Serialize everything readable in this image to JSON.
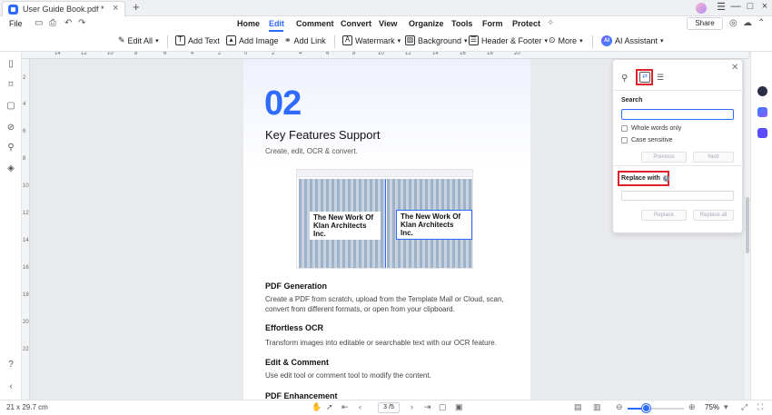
{
  "titlebar": {
    "tab_title": "User Guide Book.pdf *",
    "tab_close": "×",
    "tab_add": "+",
    "win_menu": "☰",
    "win_min": "—",
    "win_max": "□",
    "win_close": "×"
  },
  "menubar": {
    "file": "File",
    "tabs": [
      "Home",
      "Edit",
      "Comment",
      "Convert",
      "View",
      "Organize",
      "Tools",
      "Form",
      "Protect"
    ],
    "active_tab": "Edit",
    "share": "Share",
    "accent": "#2f6bff"
  },
  "toolbar": {
    "edit_all": "Edit All",
    "add_text": "Add Text",
    "add_image": "Add Image",
    "add_link": "Add Link",
    "watermark": "Watermark",
    "background": "Background",
    "header_footer": "Header & Footer",
    "more": "More",
    "ai_assistant": "AI Assistant",
    "ai_badge": "AI"
  },
  "ruler": {
    "h_marks": [
      "14",
      "12",
      "10",
      "8",
      "6",
      "4",
      "2",
      "0",
      "2",
      "4",
      "6",
      "8",
      "10",
      "12",
      "14",
      "16",
      "18",
      "20"
    ],
    "v_marks": [
      "2",
      "4",
      "6",
      "8",
      "10",
      "12",
      "14",
      "16",
      "18",
      "20",
      "22"
    ]
  },
  "document": {
    "chapter_number": "02",
    "chapter_title": "Key Features Support",
    "chapter_subtitle": "Create, edit, OCR & convert.",
    "preview_text_left": "The New Work Of Klan Architects Inc.",
    "preview_text_right": "The New Work Of Klan Architects Inc.",
    "sections": [
      {
        "heading": "PDF Generation",
        "body": "Create a PDF from scratch, upload from the Template Mall or Cloud, scan, convert from different formats, or open from your clipboard."
      },
      {
        "heading": "Effortless OCR",
        "body": "Transform images into editable or searchable text with our OCR feature."
      },
      {
        "heading": "Edit & Comment",
        "body": "Use edit tool or comment tool to modify the content."
      },
      {
        "heading": "PDF Enhancement",
        "body": ""
      }
    ]
  },
  "search_panel": {
    "search_label": "Search",
    "search_value": "",
    "whole_words": "Whole words only",
    "case_sensitive": "Case sensitive",
    "previous": "Previous",
    "next": "Next",
    "replace_with": "Replace with",
    "replace_value": "",
    "replace": "Replace",
    "replace_all": "Replace all",
    "info": "i",
    "highlight_color": "#e0202b"
  },
  "statusbar": {
    "page_size": "21 x 29.7 cm",
    "page_indicator": "3 /5",
    "zoom": "75%"
  }
}
